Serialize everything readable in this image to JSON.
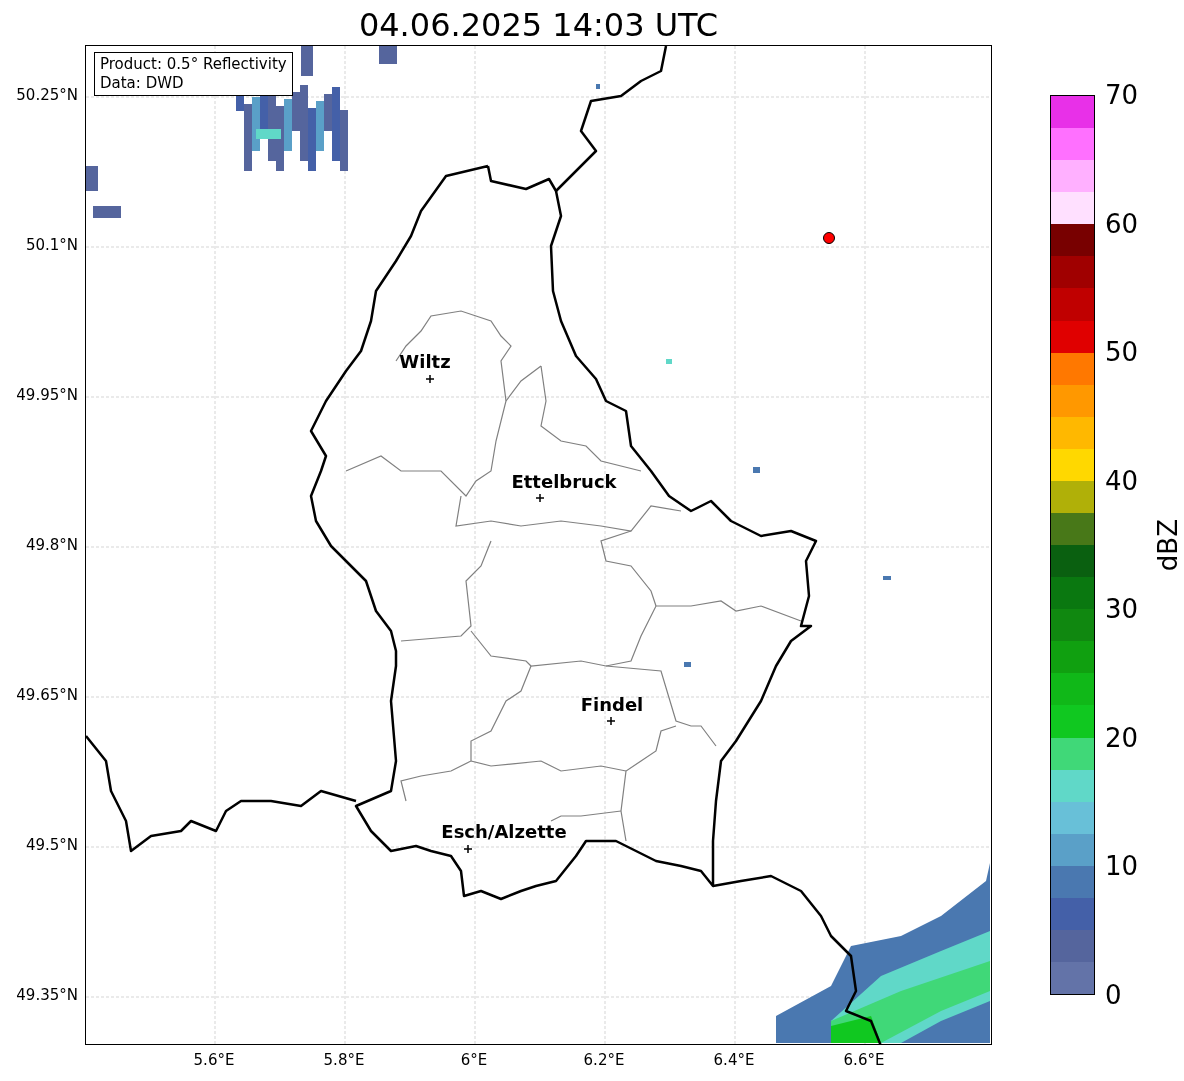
{
  "title": "04.06.2025 14:03 UTC",
  "info_box": [
    "Product: 0.5° Reflectivity",
    "Data: DWD"
  ],
  "lat_ticks": [
    "50.25°N",
    "50.1°N",
    "49.95°N",
    "49.8°N",
    "49.65°N",
    "49.5°N",
    "49.35°N"
  ],
  "lon_ticks": [
    "5.6°E",
    "5.8°E",
    "6°E",
    "6.2°E",
    "6.4°E",
    "6.6°E"
  ],
  "cities": [
    {
      "name": "Wiltz"
    },
    {
      "name": "Ettelbruck"
    },
    {
      "name": "Findel"
    },
    {
      "name": "Esch/Alzette"
    }
  ],
  "colorbar": {
    "label": "dBZ",
    "ticks": [
      "70",
      "60",
      "50",
      "40",
      "30",
      "20",
      "10",
      "0"
    ],
    "bands": [
      {
        "color": "#e830e8"
      },
      {
        "color": "#ff70ff"
      },
      {
        "color": "#ffb0ff"
      },
      {
        "color": "#ffe0ff"
      },
      {
        "color": "#780000"
      },
      {
        "color": "#a00000"
      },
      {
        "color": "#c00000"
      },
      {
        "color": "#e00000"
      },
      {
        "color": "#ff7800"
      },
      {
        "color": "#ff9800"
      },
      {
        "color": "#ffb800"
      },
      {
        "color": "#ffd800"
      },
      {
        "color": "#b0b008"
      },
      {
        "color": "#487818"
      },
      {
        "color": "#0a6010"
      },
      {
        "color": "#0a7810"
      },
      {
        "color": "#108810"
      },
      {
        "color": "#10a010"
      },
      {
        "color": "#10b818"
      },
      {
        "color": "#10c820"
      },
      {
        "color": "#40d878"
      },
      {
        "color": "#60d8c8"
      },
      {
        "color": "#68c0d8"
      },
      {
        "color": "#5aa0c8"
      },
      {
        "color": "#4a78b0"
      },
      {
        "color": "#4460a8"
      },
      {
        "color": "#55659d"
      },
      {
        "color": "#6373a8"
      }
    ]
  }
}
